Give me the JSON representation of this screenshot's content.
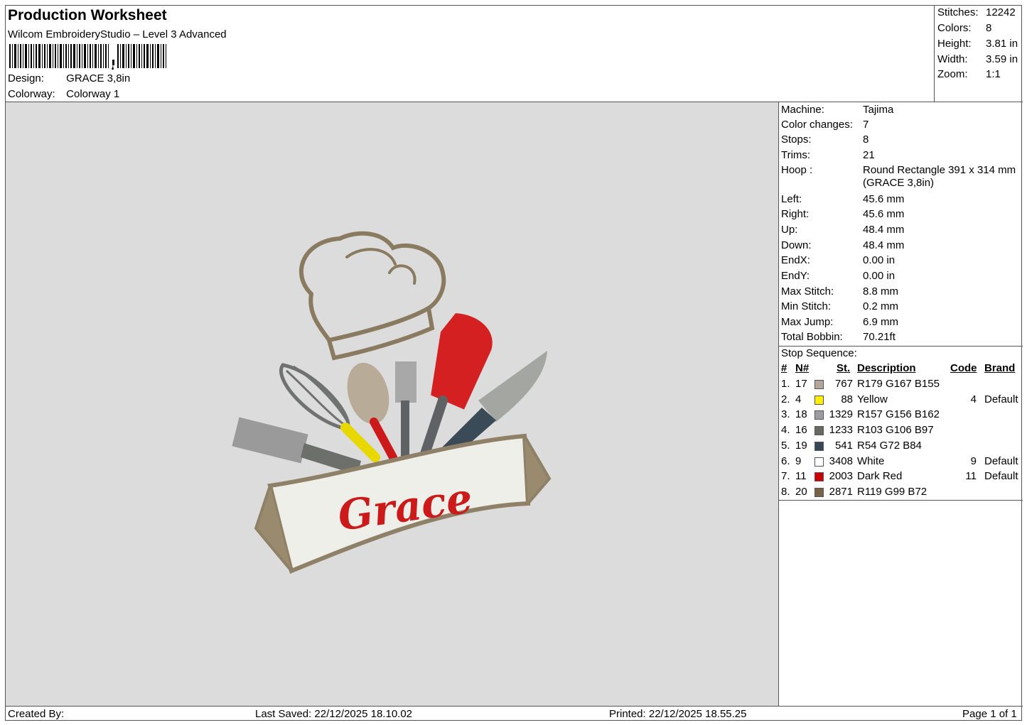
{
  "header": {
    "title": "Production Worksheet",
    "software": "Wilcom EmbroideryStudio – Level 3 Advanced",
    "design_label": "Design:",
    "design_value": "GRACE 3,8in",
    "colorway_label": "Colorway:",
    "colorway_value": "Colorway 1"
  },
  "stats": [
    {
      "label": "Stitches:",
      "value": "12242"
    },
    {
      "label": "Colors:",
      "value": "8"
    },
    {
      "label": "Height:",
      "value": "3.81 in"
    },
    {
      "label": "Width:",
      "value": "3.59 in"
    },
    {
      "label": "Zoom:",
      "value": "1:1"
    }
  ],
  "machine_info": [
    {
      "label": "Machine:",
      "value": "Tajima"
    },
    {
      "label": "Color changes:",
      "value": "7"
    },
    {
      "label": "Stops:",
      "value": "8"
    },
    {
      "label": "Trims:",
      "value": "21"
    },
    {
      "label": "Hoop :",
      "value": "Round Rectangle 391 x 314 mm (GRACE 3,8in)"
    },
    {
      "label": "Left:",
      "value": "45.6 mm"
    },
    {
      "label": "Right:",
      "value": "45.6 mm"
    },
    {
      "label": "Up:",
      "value": "48.4 mm"
    },
    {
      "label": "Down:",
      "value": "48.4 mm"
    },
    {
      "label": "EndX:",
      "value": "0.00 in"
    },
    {
      "label": "EndY:",
      "value": "0.00 in"
    },
    {
      "label": "Max Stitch:",
      "value": "8.8 mm"
    },
    {
      "label": "Min Stitch:",
      "value": "0.2 mm"
    },
    {
      "label": "Max Jump:",
      "value": "6.9 mm"
    },
    {
      "label": "Total Bobbin:",
      "value": "70.21ft"
    }
  ],
  "stop_sequence": {
    "title": "Stop Sequence:",
    "columns": [
      "#",
      "N#",
      "St.",
      "Description",
      "Code",
      "Brand"
    ],
    "rows": [
      {
        "idx": "1.",
        "n": "17",
        "color": "#b3a79b",
        "st": "767",
        "desc": "R179 G167 B155",
        "code": "",
        "brand": ""
      },
      {
        "idx": "2.",
        "n": "4",
        "color": "#ffee00",
        "st": "88",
        "desc": "Yellow",
        "code": "4",
        "brand": "Default"
      },
      {
        "idx": "3.",
        "n": "18",
        "color": "#9d9ca2",
        "st": "1329",
        "desc": "R157 G156 B162",
        "code": "",
        "brand": ""
      },
      {
        "idx": "4.",
        "n": "16",
        "color": "#676a61",
        "st": "1233",
        "desc": "R103 G106 B97",
        "code": "",
        "brand": ""
      },
      {
        "idx": "5.",
        "n": "19",
        "color": "#364854",
        "st": "541",
        "desc": "R54 G72 B84",
        "code": "",
        "brand": ""
      },
      {
        "idx": "6.",
        "n": "9",
        "color": "#ffffff",
        "st": "3408",
        "desc": "White",
        "code": "9",
        "brand": "Default"
      },
      {
        "idx": "7.",
        "n": "11",
        "color": "#cc0000",
        "st": "2003",
        "desc": "Dark Red",
        "code": "11",
        "brand": "Default"
      },
      {
        "idx": "8.",
        "n": "20",
        "color": "#776348",
        "st": "2871",
        "desc": "R119 G99 B72",
        "code": "",
        "brand": ""
      }
    ]
  },
  "design_preview": {
    "name_text": "Grace"
  },
  "footer": {
    "created_by": "Created By:",
    "last_saved": "Last Saved: 22/12/2025 18.10.02",
    "printed": "Printed: 22/12/2025 18.55.25",
    "page": "Page 1 of 1"
  }
}
